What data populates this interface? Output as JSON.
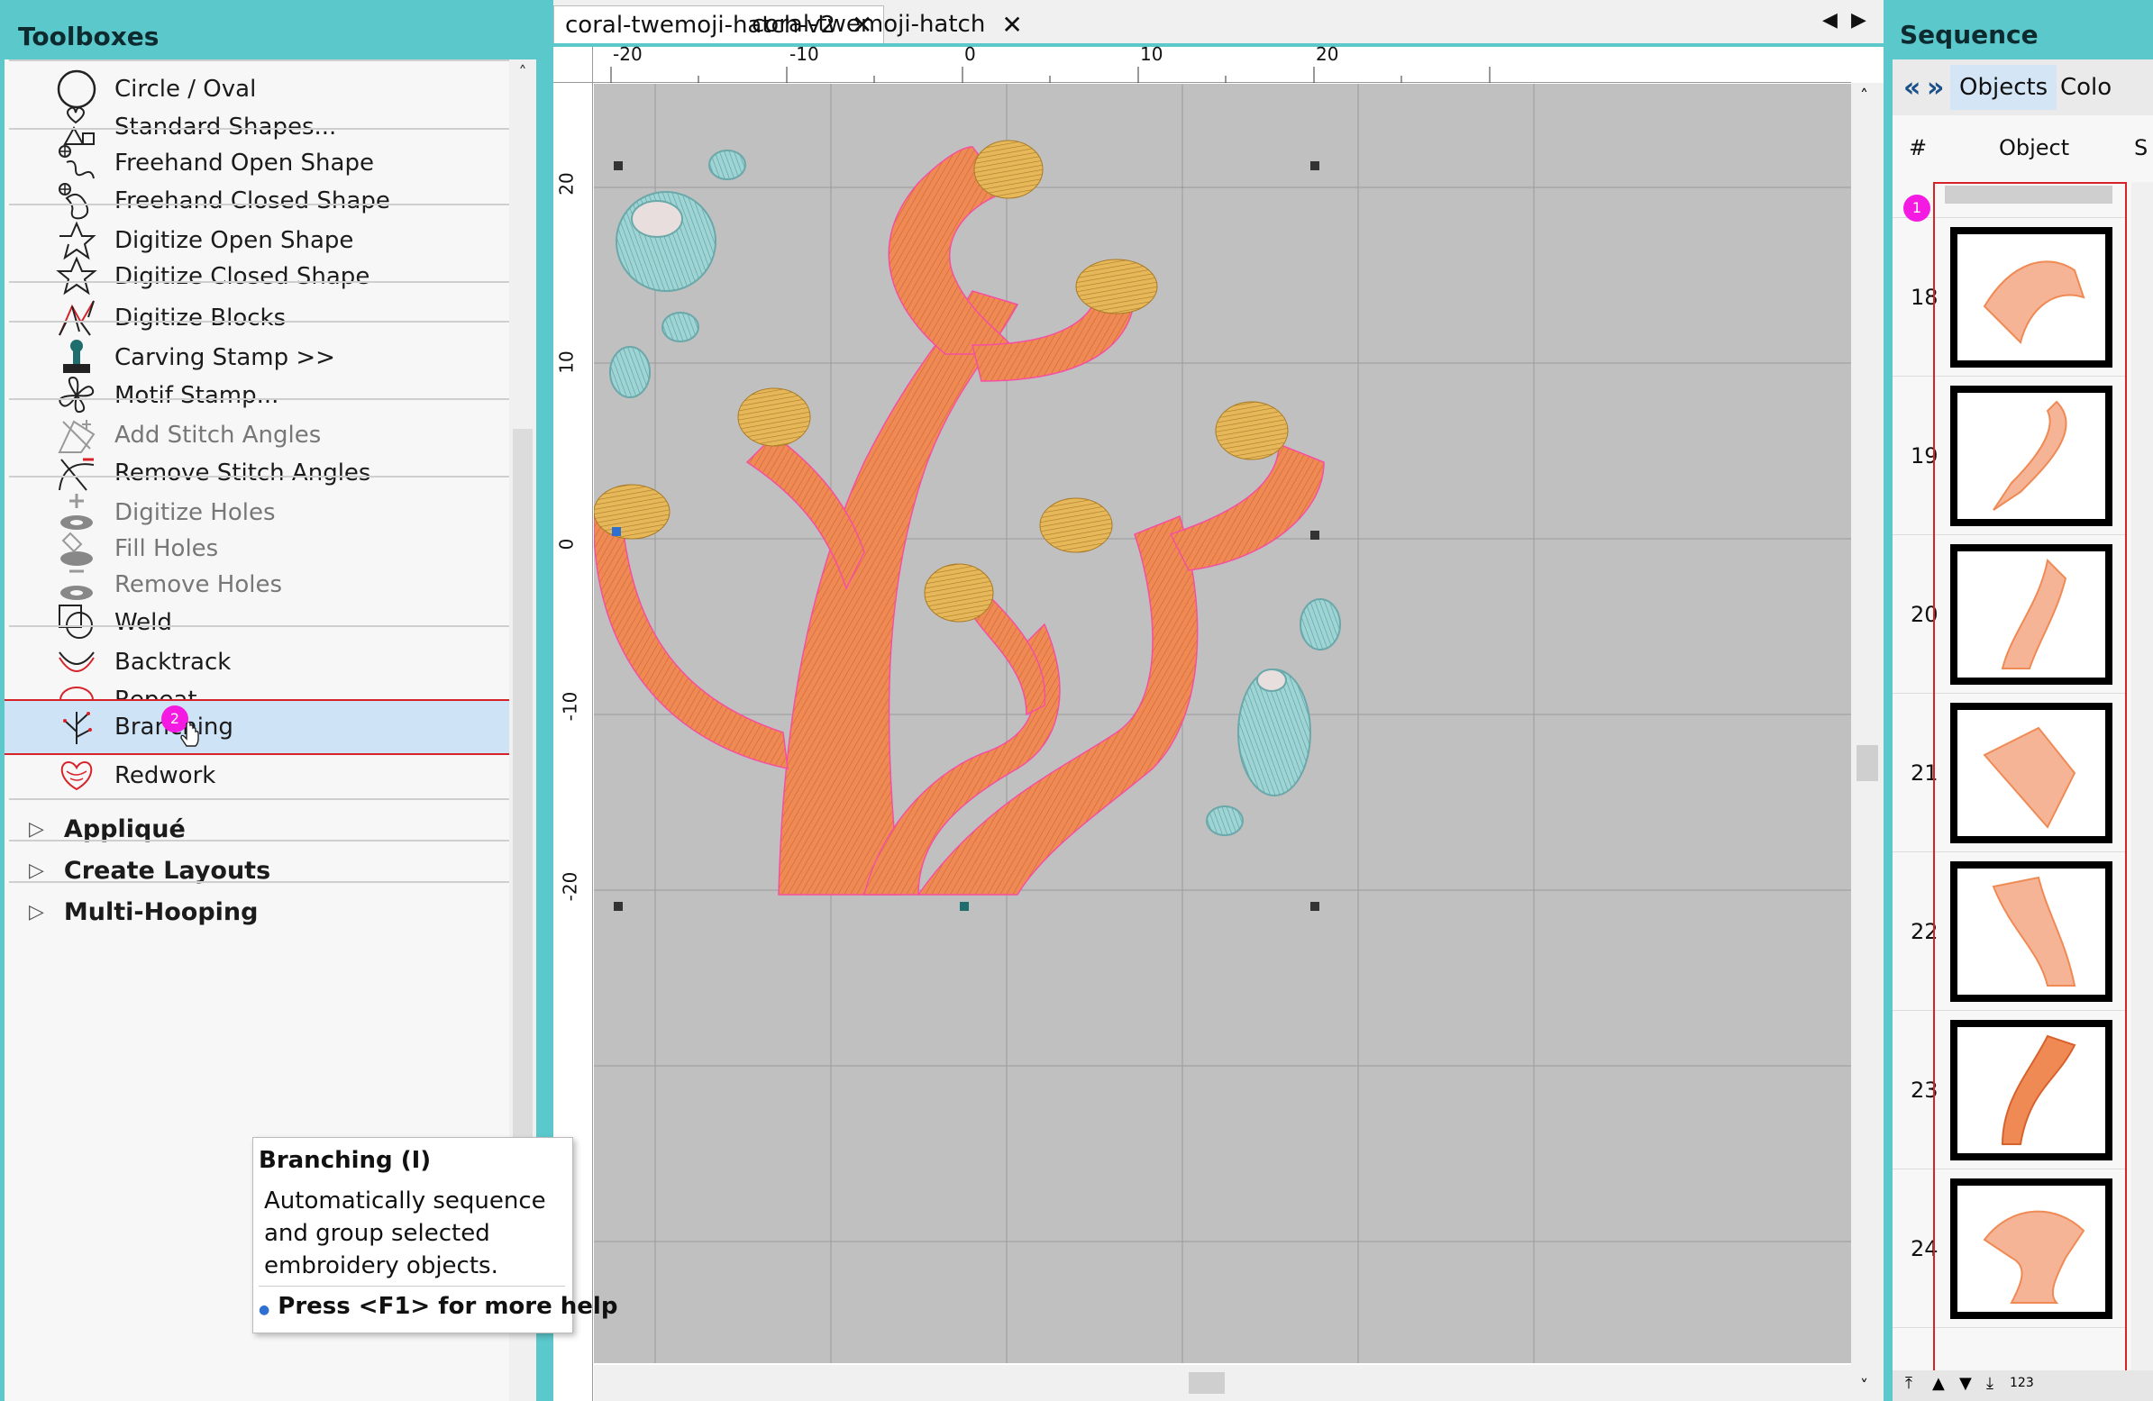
{
  "toolboxes": {
    "title": "Toolboxes",
    "items": [
      {
        "label": "Circle / Oval",
        "enabled": true
      },
      {
        "label": "Standard Shapes...",
        "enabled": true
      },
      {
        "label": "Freehand Open Shape",
        "enabled": true
      },
      {
        "label": "Freehand Closed Shape",
        "enabled": true
      },
      {
        "label": "Digitize Open Shape",
        "enabled": true
      },
      {
        "label": "Digitize Closed Shape",
        "enabled": true
      },
      {
        "label": "Digitize Blocks",
        "enabled": true
      },
      {
        "label": "Carving Stamp >>",
        "enabled": true
      },
      {
        "label": "Motif Stamp...",
        "enabled": true
      },
      {
        "label": "Add Stitch Angles",
        "enabled": false
      },
      {
        "label": "Remove Stitch Angles",
        "enabled": true
      },
      {
        "label": "Digitize Holes",
        "enabled": false
      },
      {
        "label": "Fill Holes",
        "enabled": false
      },
      {
        "label": "Remove Holes",
        "enabled": false
      },
      {
        "label": "Weld",
        "enabled": true
      },
      {
        "label": "Backtrack",
        "enabled": true
      },
      {
        "label": "Repeat",
        "enabled": true
      },
      {
        "label": "Branching",
        "enabled": true,
        "selected": true
      },
      {
        "label": "Redwork",
        "enabled": true
      }
    ],
    "sections": [
      "Appliqué",
      "Create Layouts",
      "Multi-Hooping"
    ],
    "callout_badge_branching": "2"
  },
  "tooltip": {
    "title": "Branching (I)",
    "description": "Automatically sequence and group selected embroidery objects.",
    "help": "Press <F1> for more help"
  },
  "tabs": [
    {
      "label": "coral-twemoji-hatch-v2",
      "active": true
    },
    {
      "label": "coral-twemoji-hatch",
      "active": false
    }
  ],
  "rulers": {
    "top": [
      "-20",
      "-10",
      "0",
      "10",
      "20"
    ],
    "left": [
      "20",
      "10",
      "0",
      "-10",
      "-20"
    ]
  },
  "sequence": {
    "title": "Sequence",
    "tabs": [
      "Objects",
      "Colo"
    ],
    "columns": [
      "#",
      "Object",
      "S"
    ],
    "callout_badge": "1",
    "rows": [
      "18",
      "19",
      "20",
      "21",
      "22",
      "23",
      "24"
    ],
    "footer_label": "123"
  },
  "colors": {
    "panel_accent": "#5bc8cc",
    "coral": "#f08a55",
    "coral_dark": "#c96534",
    "tip_gold": "#e6b85a",
    "bubble": "#9fd4d4",
    "badge": "#f41ae1",
    "selection_border": "#d8222a"
  }
}
